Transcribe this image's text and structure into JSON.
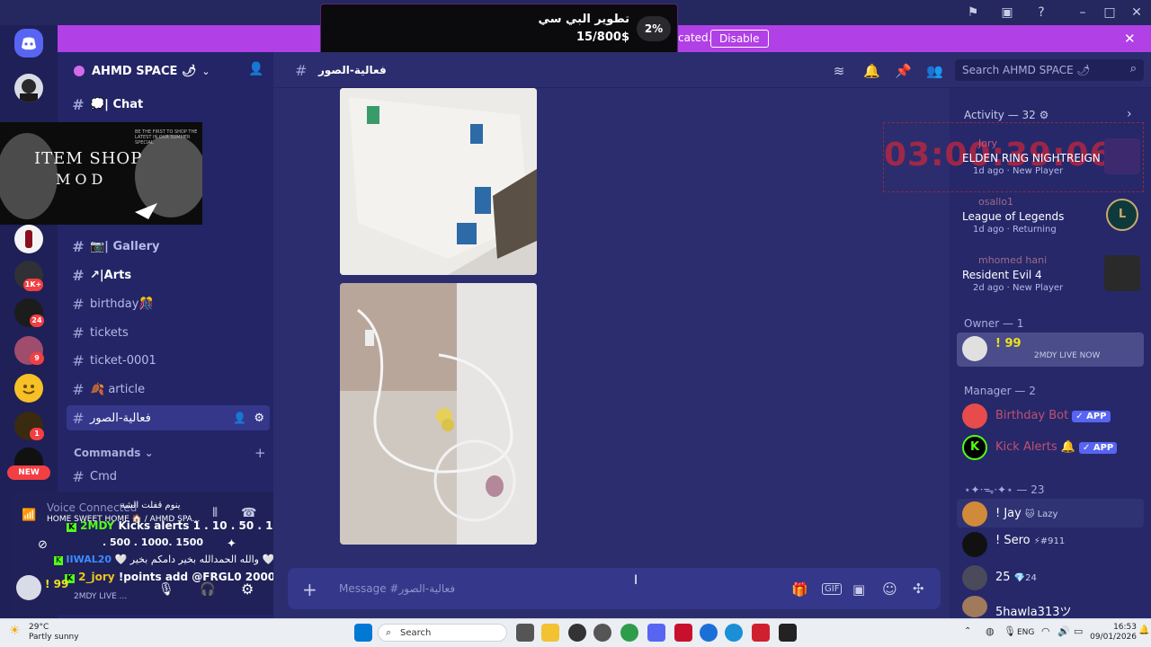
{
  "banner": {
    "text": "cated.",
    "disable_label": "Disable"
  },
  "goal": {
    "title": "تطوير البي سي",
    "progress_text": "15/800$",
    "percent_label": "2%"
  },
  "server": {
    "name": "AHMD SPACE 🌶"
  },
  "channels": [
    {
      "label": "💭| Chat"
    },
    {
      "label": "📷| Gallery"
    },
    {
      "label": "↗|Arts"
    },
    {
      "label": "birthday🎊"
    },
    {
      "label": "tickets"
    },
    {
      "label": "ticket-0001"
    },
    {
      "label": "🍂 article"
    },
    {
      "label": "فعالية-الصور"
    },
    {
      "label": "Cmd"
    }
  ],
  "category": {
    "label": "Commands"
  },
  "overlay_shop": {
    "line1": "ITEM SHOP",
    "line2": "MOD",
    "tagline": "BE THE FIRST TO SHOP THE LATEST IN OUR SUMMER SPECIAL"
  },
  "voice": {
    "status": "Voice Connected",
    "sub": "HOME SWEET HOME 🏠 / AHMD SPA...",
    "mention": "ينوم قفلت الشة"
  },
  "chat_overlay": {
    "line1_user": "2MDY",
    "line1_text": "Kicks alerts 1 . 10 . 50 . 100",
    "line2_text": ". 500 . 1000. 1500",
    "line3_user": "IIWAL20",
    "line3_text": "🤍 والله الحمدالله بخير دامكم بخير 🤍",
    "line4_user": "2_jory",
    "line4_text": "!points add @FRGL0 2000"
  },
  "user_panel": {
    "name": "! 99",
    "status": "2MDY LIVE ..."
  },
  "channel_header": {
    "name": "فعالية-الصور",
    "search_placeholder": "Search AHMD SPACE 🌶"
  },
  "composer": {
    "placeholder": "Message #فعالية-الصور"
  },
  "activity": {
    "header": "Activity — 32 ⚙",
    "timer": "03:00:39:06",
    "items": [
      {
        "user": "Jory",
        "game": "ELDEN RING NIGHTREIGN",
        "meta": "1d ago",
        "tag": "New Player"
      },
      {
        "user": "osallo1",
        "game": "League of Legends",
        "meta": "1d ago",
        "tag": "Returning"
      },
      {
        "user": "mhomed hani",
        "game": "Resident Evil 4",
        "meta": "2d ago",
        "tag": "New Player"
      }
    ]
  },
  "owner": {
    "header": "Owner — 1",
    "name": "! 99",
    "status": "2MDY LIVE NOW"
  },
  "managers": {
    "header": "Manager — 2",
    "items": [
      {
        "name": "Birthday Bot",
        "badge": "✓ APP"
      },
      {
        "name": "Kick Alerts 🔔",
        "badge": "✓ APP"
      }
    ]
  },
  "group3": {
    "header": "⋆✦·ᯓ·✦⋆ — 23",
    "items": [
      {
        "name": "! Jay",
        "tag": "🐱 Lazy"
      },
      {
        "name": "! Sero",
        "tag": "⚡#911"
      },
      {
        "name": "25",
        "tag": "💎24"
      },
      {
        "name": "5hawla313ツ",
        "tag": ""
      }
    ]
  },
  "server_badges": {
    "b1": "1K+",
    "b2": "24",
    "b3": "9",
    "b4": "1",
    "new": "NEW"
  },
  "taskbar": {
    "weather_temp": "29°C",
    "weather_desc": "Partly sunny",
    "search": "Search",
    "lang": "ENG",
    "time": "16:53",
    "date": "09/01/2026"
  },
  "colors": {
    "accent": "#5865f2",
    "banner": "#b140e6",
    "timer": "#d0263a",
    "green": "#53fc18"
  }
}
